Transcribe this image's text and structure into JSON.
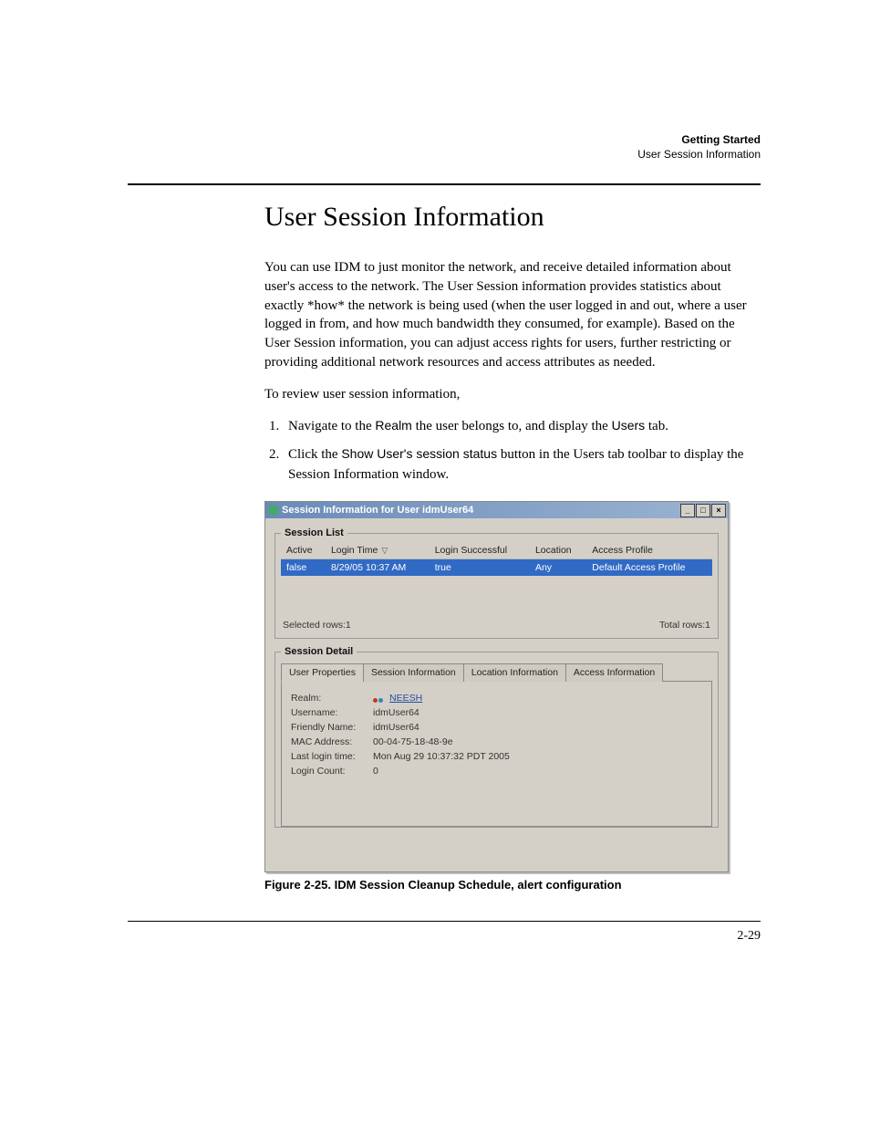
{
  "header": {
    "section": "Getting Started",
    "topic": "User Session Information"
  },
  "title": "User Session Information",
  "para1": "You can use IDM to just monitor the network, and receive detailed information about user's access to the network. The User Session information provides statistics about exactly *how* the network is being used (when the user logged in and out, where a user logged in from, and how much bandwidth they consumed, for example). Based on the User Session information, you can adjust access rights for users, further restricting or providing additional network resources and access attributes as needed.",
  "para2": "To review user session information,",
  "steps": {
    "s1_a": "Navigate to the ",
    "s1_realm": "Realm",
    "s1_b": " the user belongs to, and display the ",
    "s1_users": "Users",
    "s1_c": " tab.",
    "s2_a": "Click the ",
    "s2_btn": "Show User's session status",
    "s2_b": " button in the Users tab toolbar to display the Session Information window."
  },
  "window": {
    "title": "Session Information for User idmUser64",
    "controls": {
      "minimize": "_",
      "maximize": "□",
      "close": "×"
    },
    "session_list": {
      "legend": "Session List",
      "columns": {
        "active": "Active",
        "login_time": "Login Time",
        "login_successful": "Login Successful",
        "location": "Location",
        "access_profile": "Access Profile"
      },
      "rows": [
        {
          "active": "false",
          "login_time": "8/29/05 10:37 AM",
          "login_successful": "true",
          "location": "Any",
          "access_profile": "Default Access Profile"
        }
      ],
      "selected_rows": "Selected rows:1",
      "total_rows": "Total rows:1"
    },
    "session_detail": {
      "legend": "Session Detail",
      "tabs": {
        "user_properties": "User Properties",
        "session_information": "Session Information",
        "location_information": "Location Information",
        "access_information": "Access Information"
      },
      "properties": {
        "realm_label": "Realm:",
        "realm_value": "NEESH",
        "username_label": "Username:",
        "username_value": "idmUser64",
        "friendly_label": "Friendly Name:",
        "friendly_value": "idmUser64",
        "mac_label": "MAC Address:",
        "mac_value": "00-04-75-18-48-9e",
        "lastlogin_label": "Last login time:",
        "lastlogin_value": "Mon Aug 29 10:37:32 PDT 2005",
        "logincount_label": "Login Count:",
        "logincount_value": "0"
      }
    }
  },
  "figure_caption": "Figure 2-25. IDM Session Cleanup Schedule, alert configuration",
  "page_number": "2-29"
}
